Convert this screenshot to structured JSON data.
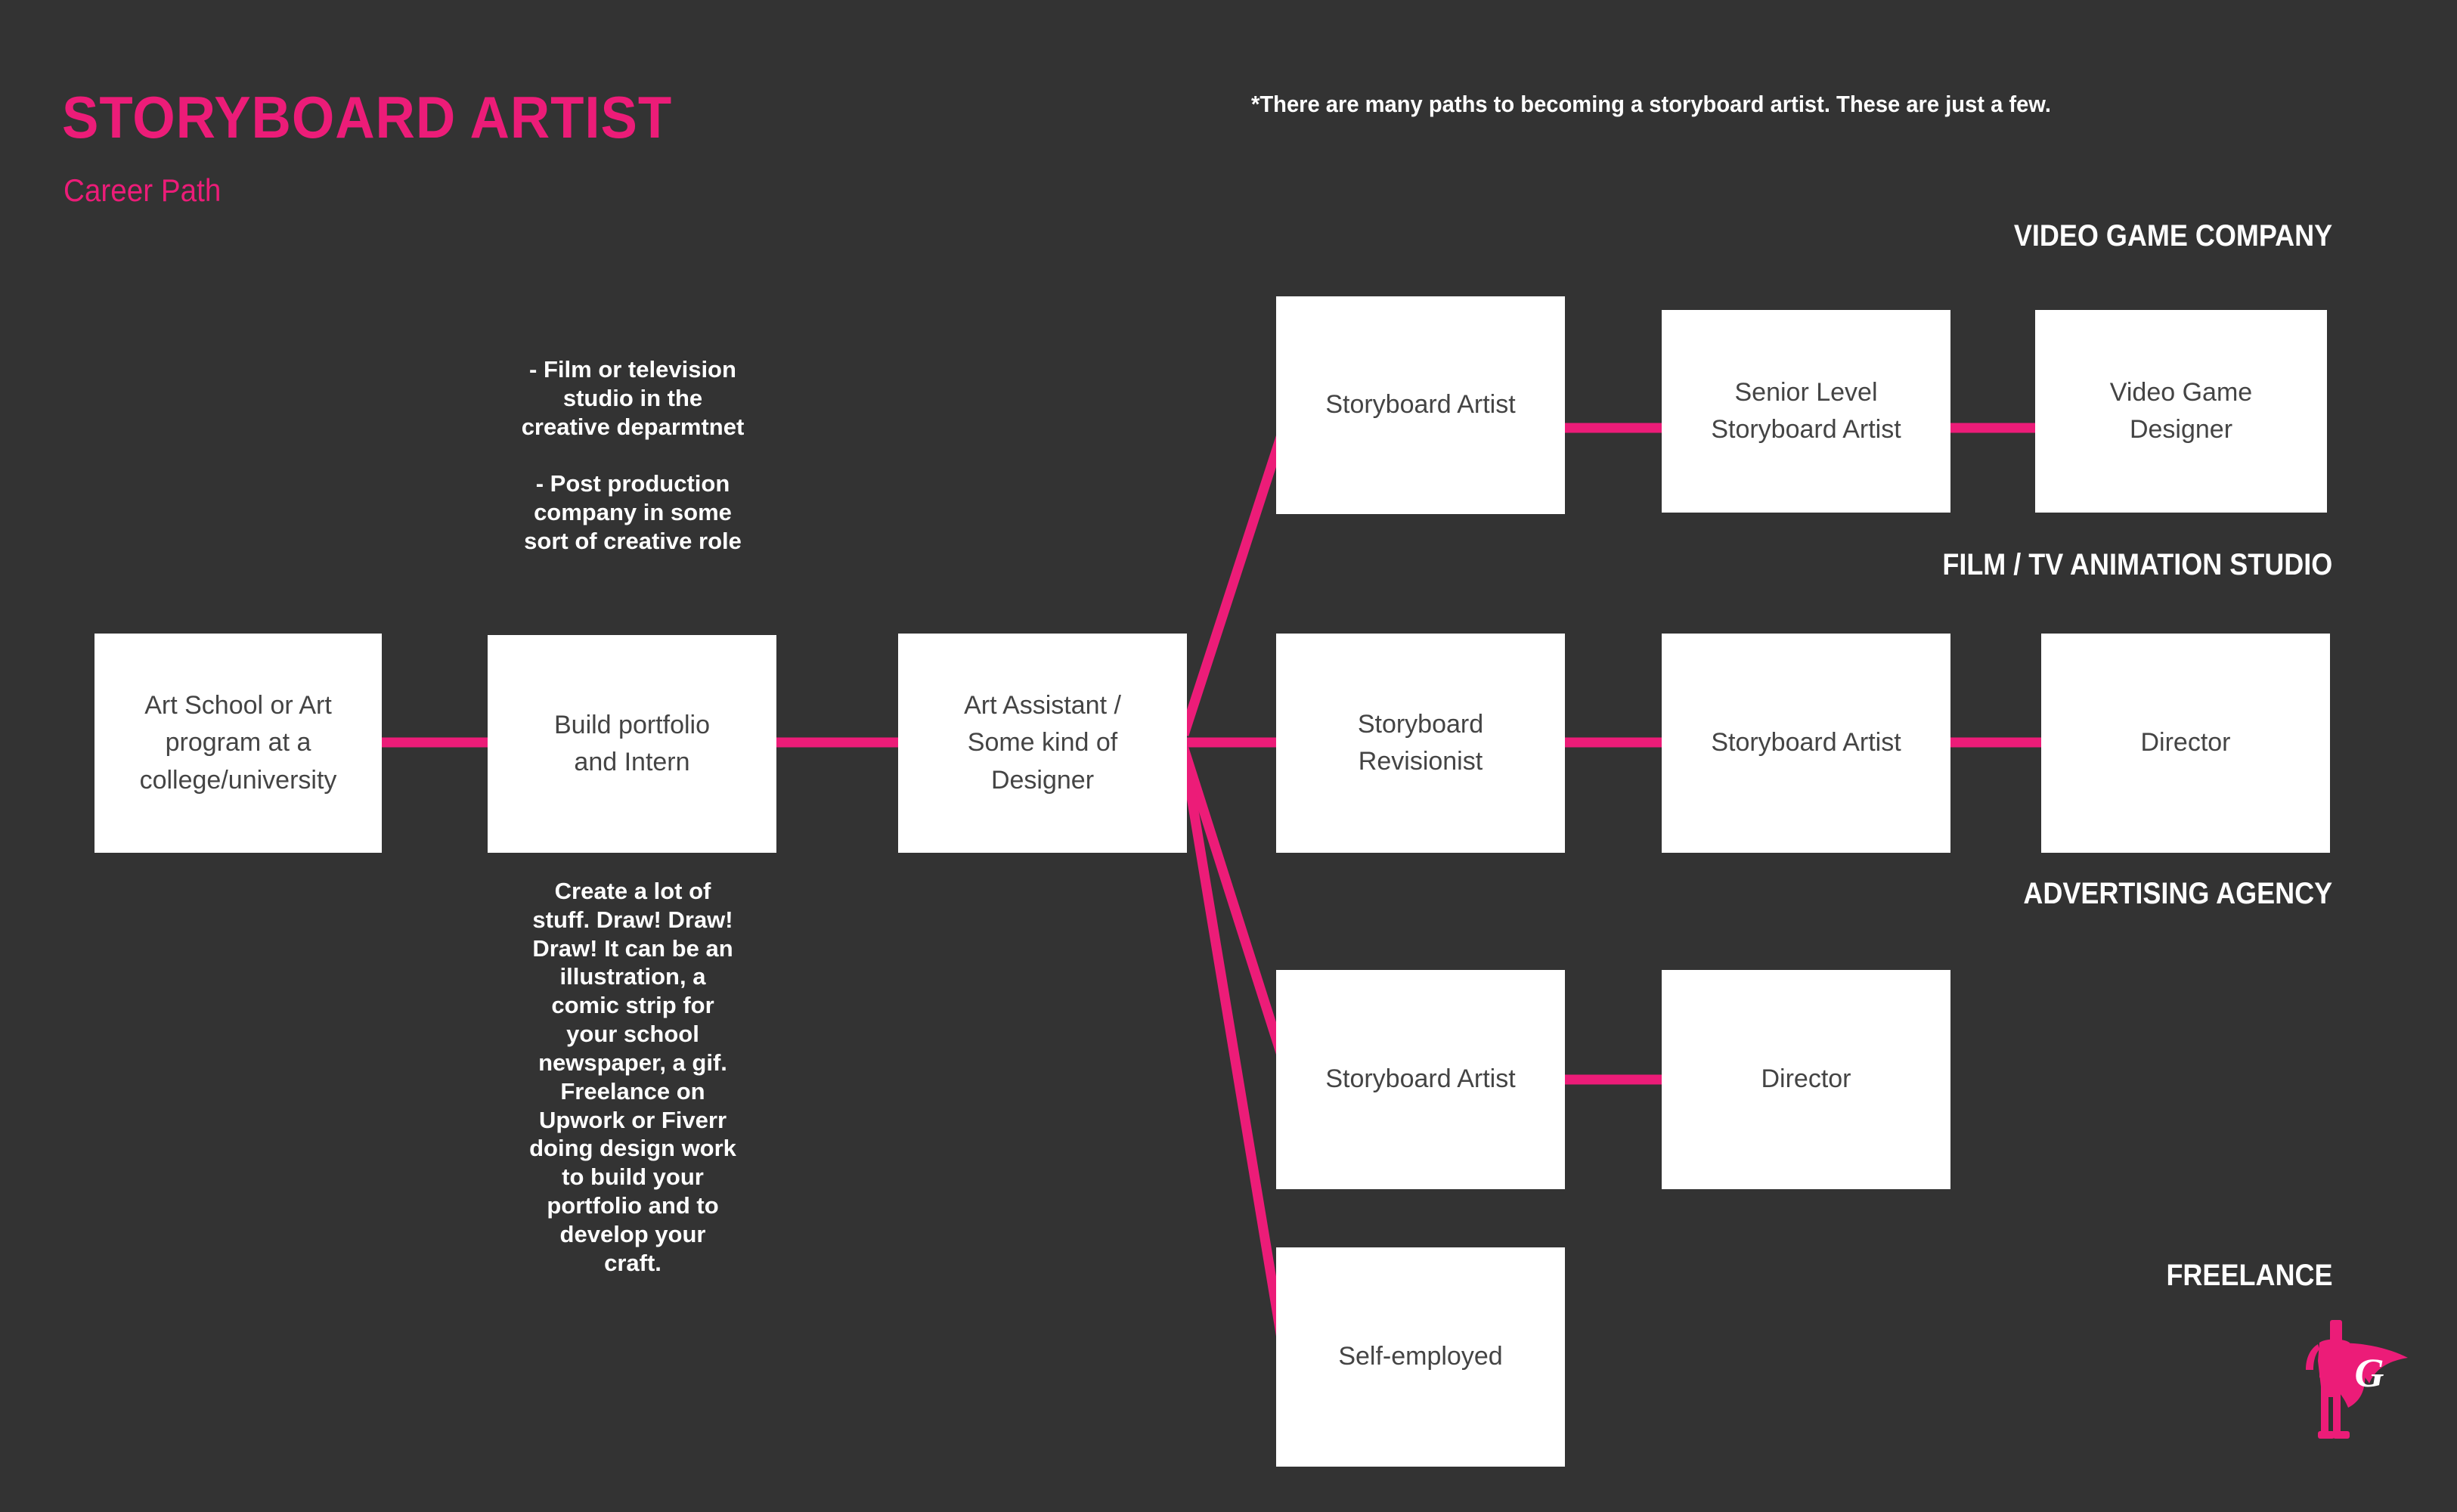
{
  "meta": {
    "background_color": "#333333",
    "accent_color": "#EC1C78",
    "box_fill": "#FFFFFF",
    "box_text_color": "#444444",
    "header_text_color": "#FFFFFF"
  },
  "header": {
    "title": "STORYBOARD ARTIST",
    "subtitle": "Career Path",
    "disclaimer": "*There are many paths to becoming a storyboard artist. These are just a few."
  },
  "sections": [
    {
      "id": "video-game-company",
      "label": "VIDEO GAME COMPANY"
    },
    {
      "id": "film-tv-animation-studio",
      "label": "FILM / TV ANIMATION STUDIO"
    },
    {
      "id": "advertising-agency",
      "label": "ADVERTISING AGENCY"
    },
    {
      "id": "freelance",
      "label": "FREELANCE"
    }
  ],
  "nodes": {
    "art_school": "Art School or Art\nprogram at a\ncollege/university",
    "build_portfolio": "Build portfolio\nand Intern",
    "art_assistant": "Art Assistant /\nSome kind of\nDesigner",
    "vg_storyboard_artist": "Storyboard Artist",
    "vg_senior_storyboard_artist": "Senior Level\nStoryboard  Artist",
    "vg_video_game_designer": "Video Game\nDesigner",
    "film_storyboard_revisionist": "Storyboard\nRevisionist",
    "film_storyboard_artist": "Storyboard Artist",
    "film_director": "Director",
    "ad_storyboard_artist": "Storyboard Artist",
    "ad_director": "Director",
    "freelance_self_employed": "Self-employed"
  },
  "notes": {
    "above_portfolio": "- Film or television\nstudio in the\ncreative deparmtnet\n\n- Post production\ncompany in some\nsort of creative role",
    "below_portfolio": "Create a lot of\nstuff. Draw! Draw!\nDraw! It can be an\nillustration, a\ncomic strip for\nyour school\nnewspaper, a gif.\nFreelance on\nUpwork or Fiverr\ndoing design work\nto build your\nportfolio and to\ndevelop your\ncraft."
  },
  "logo": {
    "letter": "G",
    "description": "superhero-with-cape"
  }
}
